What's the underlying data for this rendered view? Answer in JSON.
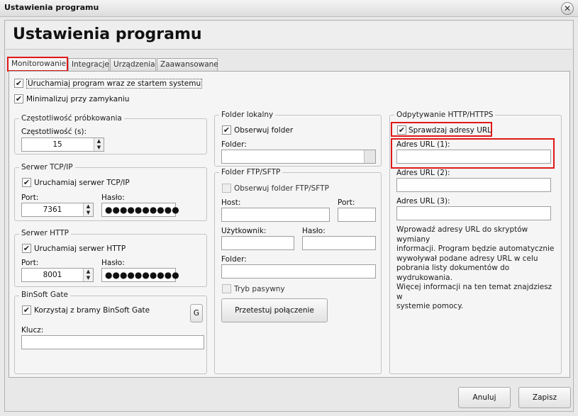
{
  "window": {
    "title": "Ustawienia programu"
  },
  "header": {
    "title": "Ustawienia programu"
  },
  "tabs": [
    {
      "label": "Monitorowanie",
      "active": true
    },
    {
      "label": "Integracje"
    },
    {
      "label": "Urządzenia"
    },
    {
      "label": "Zaawansowane"
    }
  ],
  "general": {
    "autostart_label": "Uruchamiaj program wraz ze startem systemu",
    "autostart_checked": true,
    "minimize_label": "Minimalizuj przy zamykaniu",
    "minimize_checked": true
  },
  "sampling": {
    "group_title": "Częstotliwość próbkowania",
    "freq_label": "Częstotliwość (s):",
    "freq_value": "15"
  },
  "tcp": {
    "group_title": "Serwer TCP/IP",
    "enable_label": "Uruchamiaj serwer TCP/IP",
    "enable_checked": true,
    "port_label": "Port:",
    "port_value": "7361",
    "password_label": "Hasło:",
    "password_value": "●●●●●●●●●●"
  },
  "http": {
    "group_title": "Serwer HTTP",
    "enable_label": "Uruchamiaj serwer HTTP",
    "enable_checked": true,
    "port_label": "Port:",
    "port_value": "8001",
    "password_label": "Hasło:",
    "password_value": "●●●●●●●●●●"
  },
  "gate": {
    "group_title": "BinSoft Gate",
    "enable_label": "Korzystaj z bramy BinSoft Gate",
    "enable_checked": true,
    "g_button": "G",
    "key_label": "Klucz:",
    "key_value": ""
  },
  "local_folder": {
    "group_title": "Folder lokalny",
    "observe_label": "Obserwuj folder",
    "observe_checked": true,
    "folder_label": "Folder:",
    "folder_value": ""
  },
  "ftp": {
    "group_title": "Folder FTP/SFTP",
    "observe_label": "Obserwuj folder FTP/SFTP",
    "observe_checked": false,
    "host_label": "Host:",
    "port_label": "Port:",
    "user_label": "Użytkownik:",
    "password_label": "Hasło:",
    "folder_label": "Folder:",
    "passive_label": "Tryb pasywny",
    "passive_checked": false,
    "test_button": "Przetestuj połączenie"
  },
  "url_poll": {
    "group_title": "Odpytywanie HTTP/HTTPS",
    "check_label": "Sprawdzaj adresy URL",
    "check_checked": true,
    "url1_label": "Adres URL (1):",
    "url2_label": "Adres URL (2):",
    "url3_label": "Adres URL (3):",
    "info_lines": [
      "Wprowadź adresy URL do skryptów wymiany",
      "informacji. Program będzie automatycznie",
      "wywoływał podane adresy URL w celu",
      "pobrania listy dokumentów do wydrukowania.",
      "Więcej informacji na ten temat znajdziesz w",
      "systemie pomocy."
    ]
  },
  "footer": {
    "cancel_button": "Anuluj",
    "save_button": "Zapisz"
  },
  "icons": {
    "close": "close-icon",
    "check": "checkmark-icon",
    "spin": "spin-arrows-icon"
  },
  "colors": {
    "highlight": "#e01818"
  }
}
